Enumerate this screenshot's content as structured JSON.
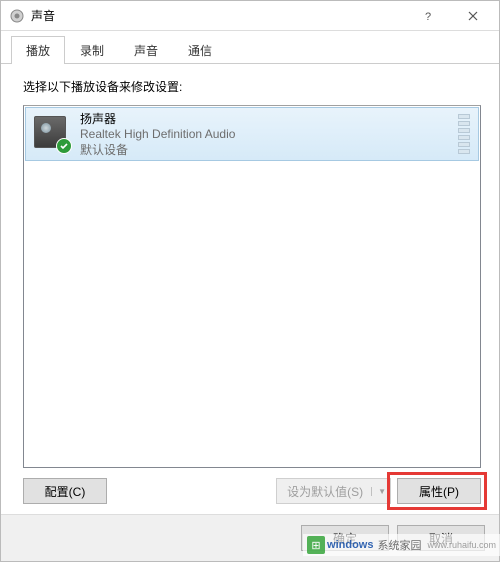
{
  "window": {
    "title": "声音"
  },
  "tabs": [
    {
      "label": "播放",
      "active": true
    },
    {
      "label": "录制",
      "active": false
    },
    {
      "label": "声音",
      "active": false
    },
    {
      "label": "通信",
      "active": false
    }
  ],
  "instruction": "选择以下播放设备来修改设置:",
  "device": {
    "name": "扬声器",
    "description": "Realtek High Definition Audio",
    "status": "默认设备"
  },
  "buttons": {
    "configure": "配置(C)",
    "set_default": "设为默认值(S)",
    "properties": "属性(P)",
    "ok": "确定",
    "cancel": "取消"
  },
  "watermark": {
    "brand": "windows",
    "suffix": "系统家园",
    "url": "www.ruhaifu.com"
  }
}
